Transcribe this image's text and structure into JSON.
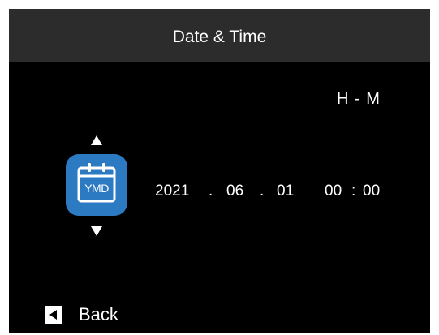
{
  "header": {
    "title": "Date & Time"
  },
  "mode_label": "H - M",
  "ymd_icon": {
    "icon": "calendar-icon",
    "text": "YMD",
    "color": "#2b7ac2"
  },
  "date": {
    "year": "2021",
    "sep1": ".",
    "month": "06",
    "sep2": ".",
    "day": "01",
    "hour": "00",
    "time_sep": ":",
    "minute": "00"
  },
  "footer": {
    "back_label": "Back",
    "back_icon": "back-icon"
  }
}
